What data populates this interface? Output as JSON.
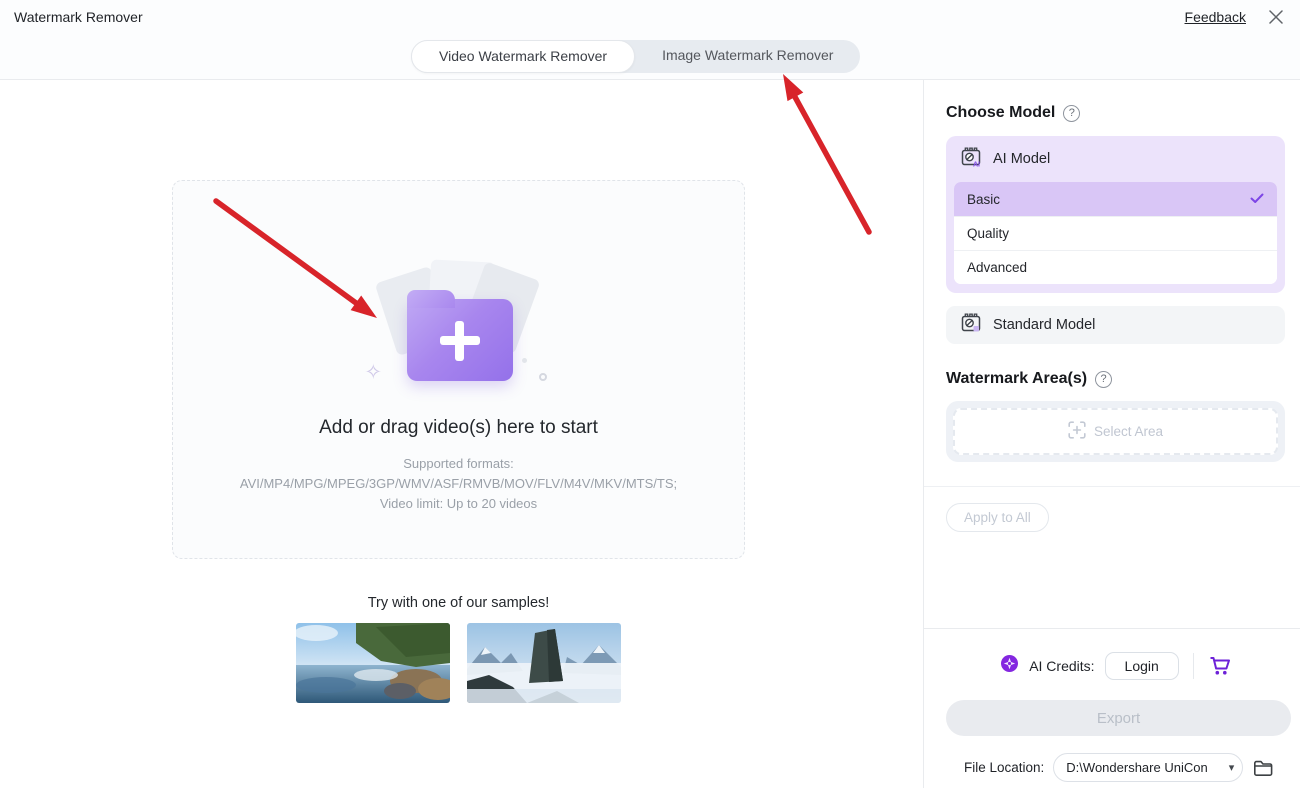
{
  "header": {
    "title": "Watermark Remover",
    "feedback_label": "Feedback",
    "tabs": [
      {
        "label": "Video Watermark Remover",
        "active": true
      },
      {
        "label": "Image Watermark Remover",
        "active": false
      }
    ]
  },
  "dropzone": {
    "title": "Add or drag video(s) here to start",
    "formats_label": "Supported formats:",
    "formats": "AVI/MP4/MPG/MPEG/3GP/WMV/ASF/RMVB/MOV/FLV/M4V/MKV/MTS/TS;",
    "limit": "Video limit: Up to 20 videos"
  },
  "samples": {
    "title": "Try with one of our samples!"
  },
  "sidebar": {
    "choose_model_label": "Choose Model",
    "ai_model_label": "AI Model",
    "model_options": [
      {
        "label": "Basic",
        "selected": true
      },
      {
        "label": "Quality",
        "selected": false
      },
      {
        "label": "Advanced",
        "selected": false
      }
    ],
    "standard_model_label": "Standard Model",
    "watermark_areas_label": "Watermark Area(s)",
    "select_area_label": "Select Area",
    "apply_to_all_label": "Apply to All"
  },
  "footer": {
    "ai_credits_label": "AI Credits:",
    "login_label": "Login",
    "export_label": "Export",
    "file_location_label": "File Location:",
    "file_location_value": "D:\\Wondershare UniCon"
  },
  "icons": {
    "question_glyph": "?",
    "caret_glyph": "▾",
    "sparkle_glyph": "✧"
  },
  "colors": {
    "accent_purple": "#7d45e6",
    "selected_row": "#d9c6f6",
    "ai_card_bg": "#ece3fb",
    "arrow_red": "#d8242a",
    "export_disabled_bg": "#e9ebef"
  }
}
